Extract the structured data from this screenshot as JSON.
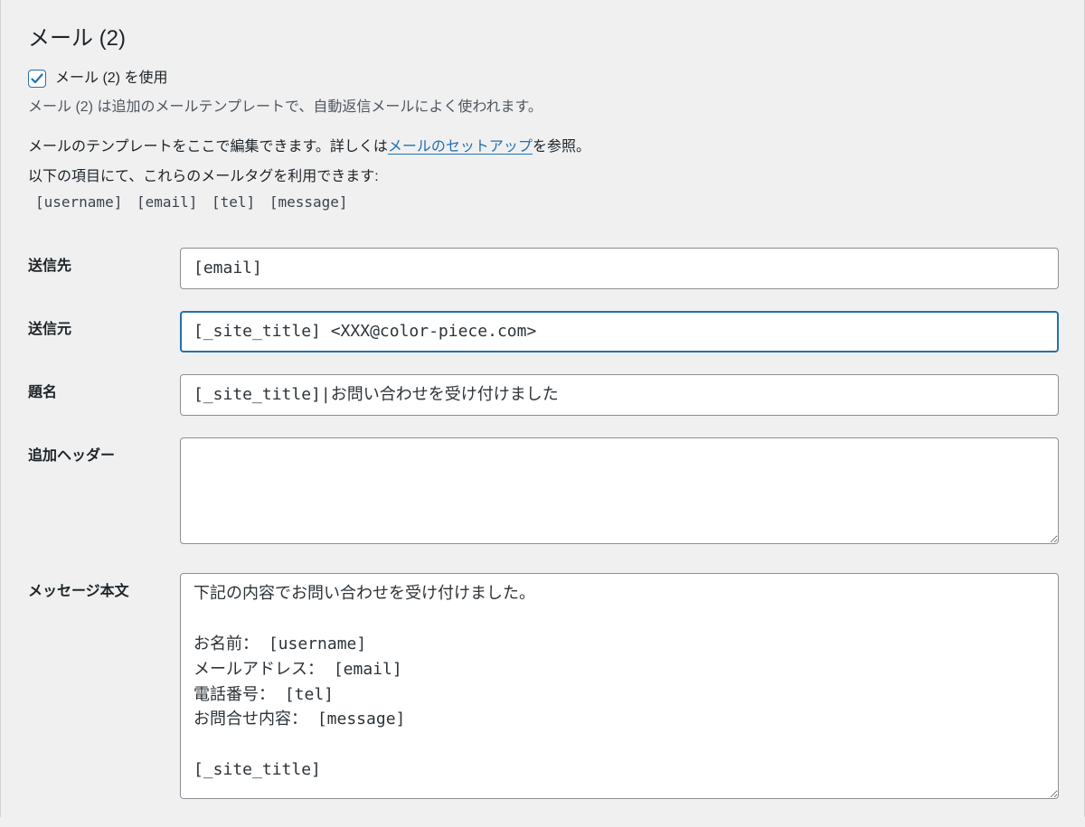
{
  "section_title": "メール (2)",
  "use_checkbox": {
    "checked": true,
    "label": "メール (2) を使用"
  },
  "desc": "メール (2) は追加のメールテンプレートで、自動返信メールによく使われます。",
  "intro_before": "メールのテンプレートをここで編集できます。詳しくは",
  "intro_link": "メールのセットアップ",
  "intro_after": "を参照。",
  "tags_note": "以下の項目にて、これらのメールタグを利用できます:",
  "tags": "[username] [email] [tel] [message]",
  "fields": {
    "to": {
      "label": "送信先",
      "value": "[email]"
    },
    "from": {
      "label": "送信元",
      "value": "[_site_title] <XXX@color-piece.com>"
    },
    "subject": {
      "label": "題名",
      "value": "[_site_title]|お問い合わせを受け付けました"
    },
    "headers": {
      "label": "追加ヘッダー",
      "value": ""
    },
    "body": {
      "label": "メッセージ本文",
      "value": "下記の内容でお問い合わせを受け付けました。\n\nお名前： [username]\nメールアドレス： [email]\n電話番号： [tel]\nお問合せ内容： [message]\n\n[_site_title]"
    }
  }
}
